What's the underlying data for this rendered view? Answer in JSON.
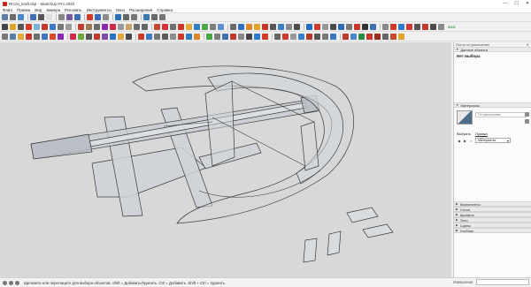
{
  "window": {
    "title": "Rrcza_kraft.skp - SketchUp Pro 2022",
    "controls": [
      "—",
      "☐",
      "✕"
    ]
  },
  "menu": [
    "Файл",
    "Правка",
    "Вид",
    "Камера",
    "Рисовать",
    "Инструменты",
    "Окно",
    "Расширения",
    "Справка"
  ],
  "toolbar": {
    "row1_colors": [
      "#5b7fa8",
      "#6b6b6b",
      "#4b86c8",
      "#3e70b5",
      "#555555",
      "#e0e0e0",
      "#888888",
      "#7a5aa0",
      "#3f6fb0",
      "#cf3a2a",
      "#3a6cb8",
      "#8c8c8c",
      "#2d6fb5",
      "#666666",
      "#777777",
      "#3c79b3",
      "#6a6a6a",
      "#777777"
    ],
    "row2_colors": [
      "#444444",
      "#e2a52b",
      "#555555",
      "#d83b2b",
      "#7ab3d9",
      "#c33a2d",
      "#3b78c3",
      "#777777",
      "#9b9b9b",
      "#c04030",
      "#a07a50",
      "#6b6b6b",
      "#8a2ab0",
      "#d02a4a",
      "#9a9a9a",
      "#c8a36a",
      "#6b6b6b",
      "#666666",
      "#c44b2d",
      "#d6343a",
      "#6e6e6e",
      "#c7392a",
      "#e3a83a",
      "#2e7fc4",
      "#4aa84a",
      "#7d7d7d",
      "#5c8fd1",
      "#6a6a6a",
      "#2f6fc2",
      "#e0872c",
      "#e2a52b",
      "#c0382c",
      "#555555",
      "#3a80c8",
      "#8a8a8a",
      "#4d4d4d",
      "#1e6fc8",
      "#d23a2b",
      "#999999",
      "#4b4b4b",
      "#2a6ab6",
      "#777777",
      "#c8372a",
      "#333333",
      "#3f6fb0",
      "#888888",
      "#cf3b2b",
      "#2f7ad0",
      "#d03838",
      "#555555",
      "#c13a2a",
      "#4a4a4a",
      "#8a8a8a"
    ],
    "row3_colors": [
      "#7a7a7a",
      "#5a7fa8",
      "#e3a93c",
      "#c9352a",
      "#6e6e6e",
      "#3e74c0",
      "#d84b2b",
      "#8a2ab0",
      "#d02a4a",
      "#6aa63a",
      "#555555",
      "#c33a2d",
      "#7b4ea8",
      "#2f6fc2",
      "#e3a83a",
      "#4b4b4b",
      "#c83a2a",
      "#3a7cc8",
      "#777777",
      "#5c5c5c",
      "#8c8c8c",
      "#c83a2a",
      "#2e7fc4",
      "#e0872c",
      "#4aa84a",
      "#7d7d7d",
      "#3f6fb0",
      "#c0382c",
      "#888888",
      "#444444",
      "#2f7ad0",
      "#d23a2b",
      "#666666",
      "#cf3b2b",
      "#999999",
      "#3a80c8",
      "#b53a2a",
      "#555555",
      "#777777",
      "#3b78c3",
      "#c33a2d",
      "#4b86c8",
      "#2c8a44",
      "#c8372a",
      "#9a3020",
      "#666666",
      "#c44b2d",
      "#e2a52b"
    ],
    "svg_label": "SVG"
  },
  "tray": {
    "header": "Лоток по умолчанию",
    "entity_panel": "Данные объекта",
    "entity_value": "Нет выбора",
    "materials_panel": "Материалы",
    "material_name_placeholder": "По умолчанию",
    "tab_select": "Выбрать",
    "tab_edit": "Правка",
    "material_dropdown": "Материалы",
    "collapsed_panels": [
      "Компоненты",
      "Стили",
      "Шрифты",
      "Тени",
      "Сцены",
      "Учебник"
    ]
  },
  "status": {
    "hint": "Щелкните или перетащите для выбора объектов. Shift = Добавить/Удалить. Ctrl = Добавить. Shift + Ctrl = Удалить.",
    "measure_label": "Измерения"
  }
}
